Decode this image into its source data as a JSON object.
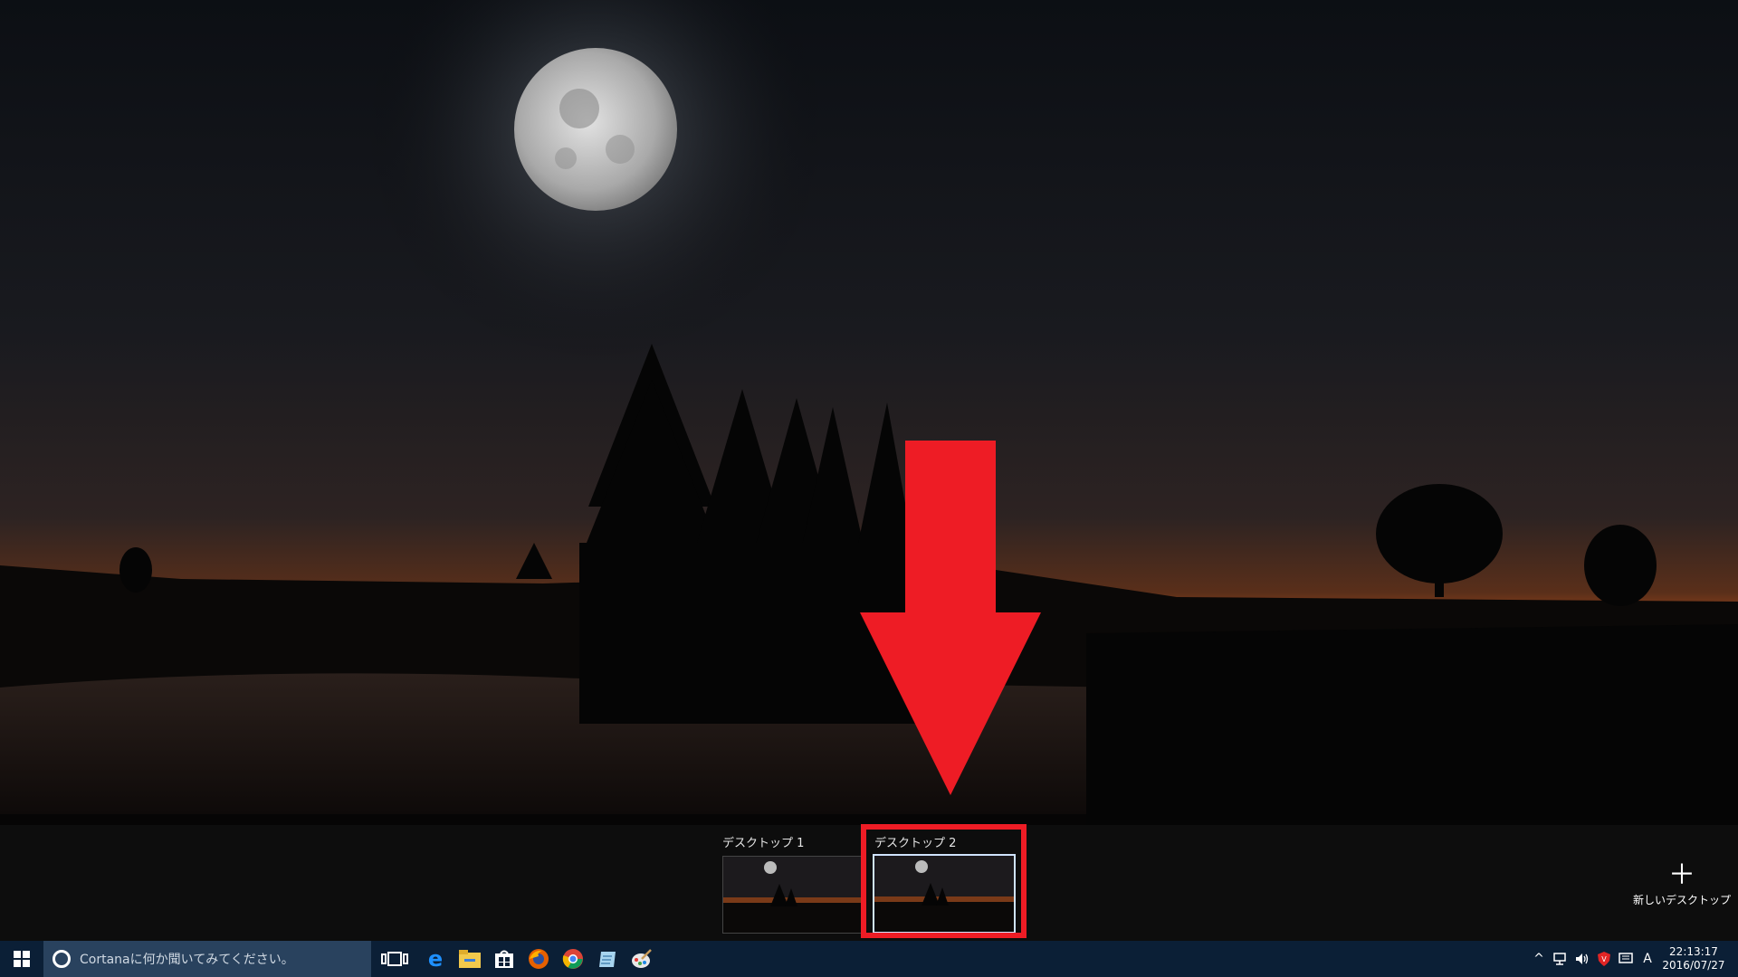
{
  "virtual_desktops": [
    {
      "label": "デスクトップ 1",
      "active": false
    },
    {
      "label": "デスクトップ 2",
      "active": true
    }
  ],
  "new_desktop": {
    "icon": "plus-icon",
    "label": "新しいデスクトップ"
  },
  "taskbar": {
    "search_placeholder": "Cortanaに何か聞いてみてください。",
    "pinned_apps": [
      "edge-icon",
      "file-explorer-icon",
      "store-icon",
      "firefox-icon",
      "chrome-icon",
      "notepad-icon",
      "paint-icon"
    ],
    "tray": {
      "ime_indicator": "A",
      "time": "22:13:17",
      "date": "2016/07/27"
    }
  },
  "colors": {
    "highlight": "#ee1c25",
    "taskbar": "#0b1f36",
    "search_box": "#29425e"
  }
}
